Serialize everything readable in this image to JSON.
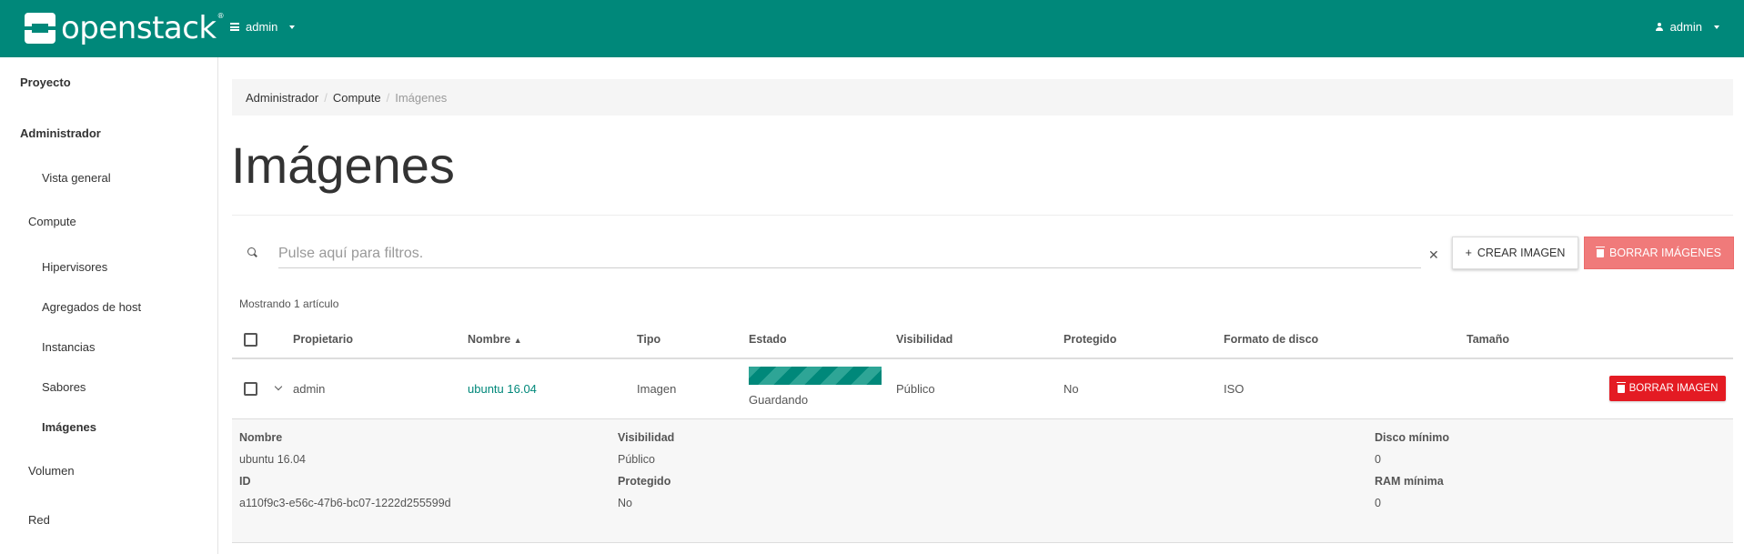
{
  "brand": {
    "logo_text": "openstack",
    "logo_tm": "®"
  },
  "topbar": {
    "project": "admin",
    "user": "admin"
  },
  "sidebar": {
    "items": [
      {
        "label": "Proyecto"
      },
      {
        "label": "Administrador"
      },
      {
        "label": "Vista general"
      },
      {
        "label": "Compute"
      },
      {
        "label": "Hipervisores"
      },
      {
        "label": "Agregados de host"
      },
      {
        "label": "Instancias"
      },
      {
        "label": "Sabores"
      },
      {
        "label": "Imágenes"
      },
      {
        "label": "Volumen"
      },
      {
        "label": "Red"
      }
    ]
  },
  "breadcrumb": {
    "items": [
      "Administrador",
      "Compute"
    ],
    "current": "Imágenes"
  },
  "page_title": "Imágenes",
  "search": {
    "placeholder": "Pulse aquí para filtros.",
    "clear": "✕"
  },
  "actions": {
    "create": "CREAR IMAGEN",
    "create_icon": "+",
    "delete_all": "BORRAR IMÁGENES"
  },
  "count_text": "Mostrando 1 artículo",
  "table": {
    "headers": [
      "Propietario",
      "Nombre",
      "Tipo",
      "Estado",
      "Visibilidad",
      "Protegido",
      "Formato de disco",
      "Tamaño"
    ],
    "sort_indicator": "▲",
    "rows": [
      {
        "owner": "admin",
        "name": "ubuntu 16.04",
        "type": "Imagen",
        "status": "Guardando",
        "visibility": "Público",
        "protected": "No",
        "disk_format": "ISO",
        "size": "",
        "delete_label": "BORRAR IMAGEN"
      }
    ]
  },
  "detail": {
    "name_label": "Nombre",
    "name_value": "ubuntu 16.04",
    "id_label": "ID",
    "id_value": "a110f9c3-e56c-47b6-bc07-1222d255599d",
    "visibility_label": "Visibilidad",
    "visibility_value": "Público",
    "protected_label": "Protegido",
    "protected_value": "No",
    "min_disk_label": "Disco mínimo",
    "min_disk_value": "0",
    "min_ram_label": "RAM mínima",
    "min_ram_value": "0"
  },
  "colors": {
    "brand": "#00887a",
    "danger": "#e41b23",
    "danger_light": "#f07a7a"
  }
}
